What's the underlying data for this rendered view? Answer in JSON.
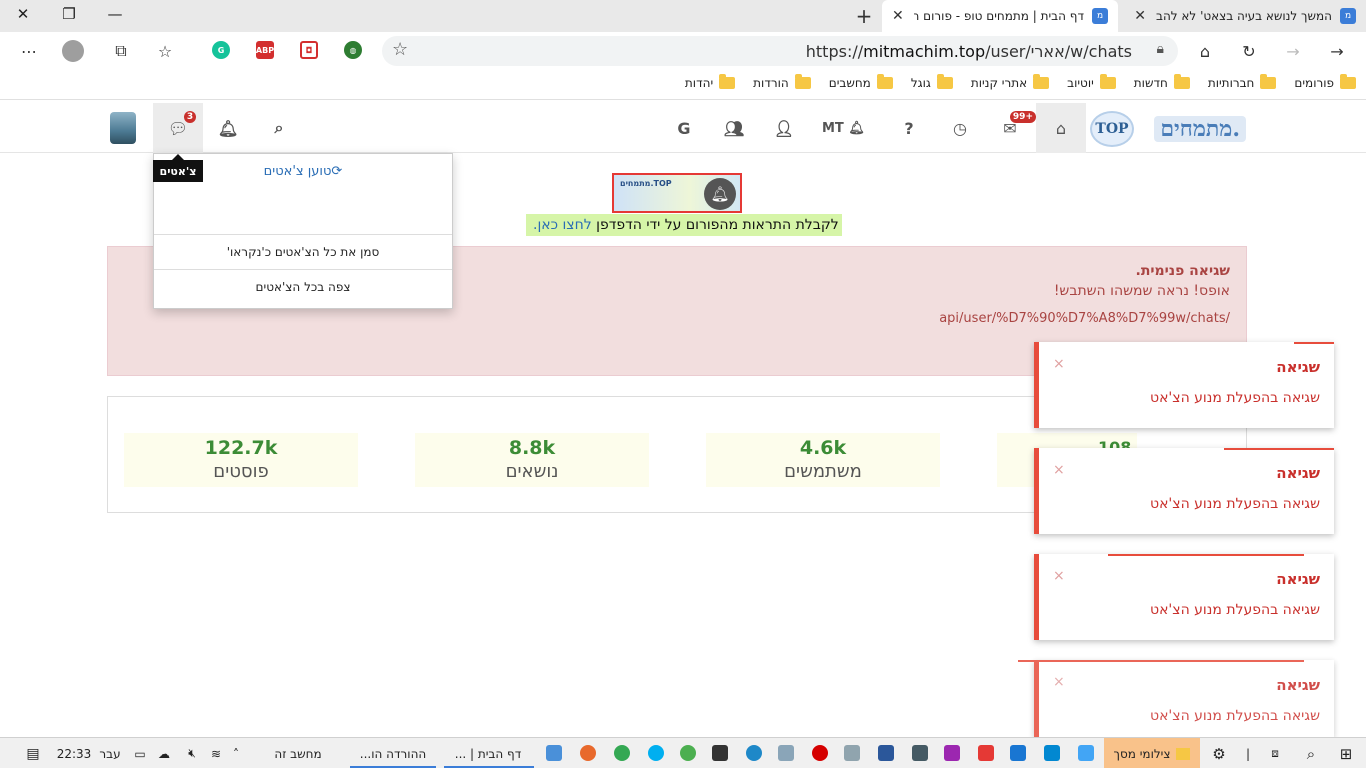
{
  "browser": {
    "tabs": [
      {
        "title": "דף הבית | מתמחים טופ - פורום ה",
        "favicon": "מ",
        "active": true
      },
      {
        "title": "המשך לנושא בעיה בצאט' לא להב",
        "favicon": "מ",
        "active": false
      }
    ],
    "url": "https://mitmachim.top/user/אארי/w/chats",
    "url_prefix": "https://",
    "url_domain": "mitmachim.top",
    "url_path": "/user/אארי/w/chats",
    "extensions": [
      "grammarly-icon",
      "adblock-icon",
      "pocket-icon",
      "globe-icon"
    ],
    "abp_label": "ABP"
  },
  "bookmarks": [
    "פורומים",
    "חברותיות",
    "חדשות",
    "יוטיוב",
    "אתרי קניות",
    "גוגל",
    "מחשבים",
    "הורדות",
    "יהדות"
  ],
  "site": {
    "logo_text": "מתמחים.",
    "logo_ball": "TOP",
    "nav": {
      "inbox_badge": "99+",
      "username_initials": "MT",
      "chat_badge": "3"
    },
    "push": {
      "image_label": "מתמחים.TOP",
      "text": "לקבלת התראות מהפורום על ידי הדפדפן",
      "link": "לחצו כאן."
    },
    "error": {
      "title": "שגיאה פנימית.",
      "message": "אופס! נראה שמשהו השתבש!",
      "path": "api/user/%D7%90%D7%A8%D7%99w/chats/"
    },
    "stats": [
      {
        "value": "122.7k",
        "label": "פוסטים"
      },
      {
        "value": "8.8k",
        "label": "נושאים"
      },
      {
        "value": "4.6k",
        "label": "משתמשים"
      }
    ],
    "stats_peek": "108",
    "chats_dropdown": {
      "tooltip": "צ'אטים",
      "loading": "טוען צ'אטים",
      "mark_all_read": "סמן את כל הצ'אטים כ'נקראו'",
      "view_all": "צפה בכל הצ'אטים"
    },
    "toasts": [
      {
        "title": "שגיאה",
        "message": "שגיאה בהפעלת מנוע הצ'אט"
      },
      {
        "title": "שגיאה",
        "message": "שגיאה בהפעלת מנוע הצ'אט"
      },
      {
        "title": "שגיאה",
        "message": "שגיאה בהפעלת מנוע הצ'אט"
      },
      {
        "title": "שגיאה",
        "message": "שגיאה בהפעלת מנוע הצ'אט"
      }
    ]
  },
  "taskbar": {
    "time": "22:33",
    "lang": "עבר",
    "items": [
      {
        "label": "צילומי מסך"
      },
      {
        "label": "דף הבית | ..."
      },
      {
        "label": "ההורדה הו..."
      },
      {
        "label": "מחשב זה"
      }
    ]
  }
}
